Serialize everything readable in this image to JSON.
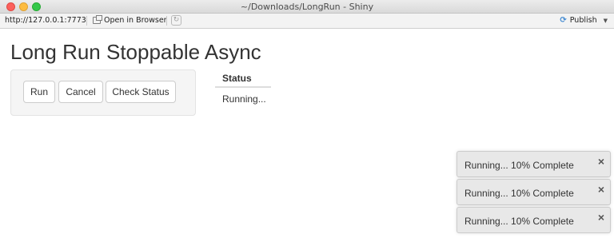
{
  "window": {
    "title": "~/Downloads/LongRun - Shiny"
  },
  "toolbar": {
    "url": "http://127.0.0.1:7773",
    "open_in_browser": "Open in Browser",
    "publish": "Publish"
  },
  "page": {
    "title": "Long Run Stoppable Async"
  },
  "buttons": {
    "run": "Run",
    "cancel": "Cancel",
    "check_status": "Check Status"
  },
  "status_table": {
    "header": "Status",
    "value": "Running..."
  },
  "notifications": [
    {
      "text": "Running... 10% Complete"
    },
    {
      "text": "Running... 10% Complete"
    },
    {
      "text": "Running... 10% Complete"
    }
  ],
  "icons": {
    "close": "×",
    "refresh": "refresh-icon",
    "publish": "publish-icon",
    "caret": "▼"
  },
  "colors": {
    "traffic_close": "#fc605c",
    "traffic_min": "#fdbc40",
    "traffic_max": "#34c84a",
    "publish_blue": "#3f88d1"
  }
}
